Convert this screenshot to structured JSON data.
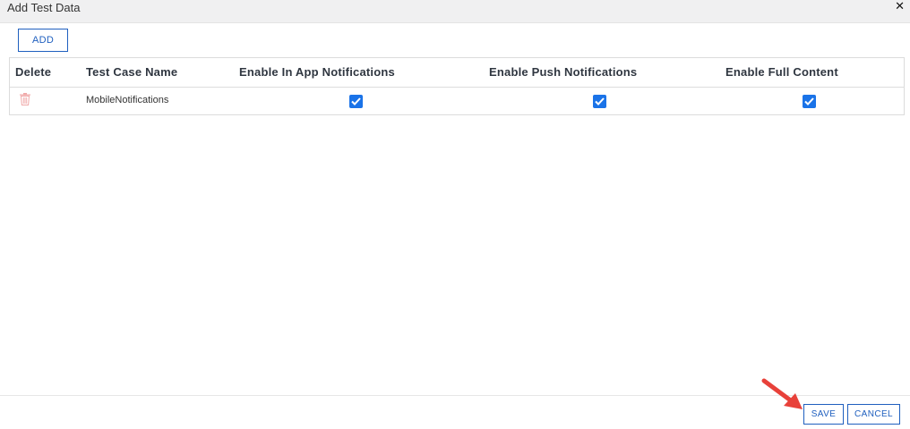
{
  "dialog": {
    "title": "Add Test Data",
    "close_glyph": "✕"
  },
  "toolbar": {
    "add_label": "ADD"
  },
  "table": {
    "columns": [
      "Delete",
      "Test Case Name",
      "Enable In App Notifications",
      "Enable Push Notifications",
      "Enable Full Content"
    ],
    "rows": [
      {
        "test_case_name": "MobileNotifications",
        "enable_in_app": true,
        "enable_push": true,
        "enable_full_content": true
      }
    ]
  },
  "footer": {
    "save_label": "SAVE",
    "cancel_label": "CANCEL"
  },
  "colors": {
    "accent": "#1f5fbf",
    "checkbox": "#1a73e8",
    "trash": "#f0a8a8",
    "annotation_arrow": "#e8413a"
  },
  "icons": {
    "delete": "trash-icon",
    "close": "close-icon",
    "check": "checkmark-icon",
    "annotation": "arrow-annotation"
  }
}
